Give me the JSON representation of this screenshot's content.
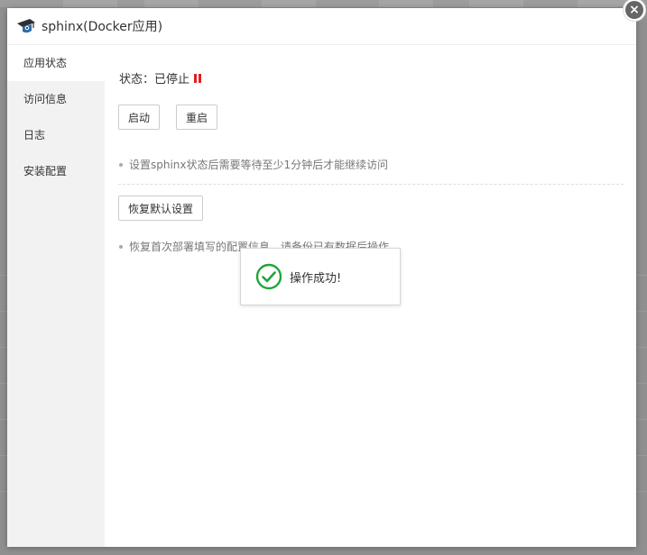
{
  "dialog": {
    "title": "sphinx(Docker应用)",
    "close_icon": "×",
    "logo_icon": "sphinx-logo-icon"
  },
  "sidebar": {
    "items": [
      {
        "label": "应用状态",
        "active": true
      },
      {
        "label": "访问信息",
        "active": false
      },
      {
        "label": "日志",
        "active": false
      },
      {
        "label": "安装配置",
        "active": false
      }
    ]
  },
  "main": {
    "status_label": "状态：已停止",
    "status_color": "#e02020",
    "start_button": "启动",
    "restart_button": "重启",
    "tip_wait": "设置sphinx状态后需要等待至少1分钟后才能继续访问",
    "restore_button": "恢复默认设置",
    "tip_restore": "恢复首次部署填写的配置信息，请备份已有数据后操作"
  },
  "toast": {
    "message": "操作成功!",
    "icon": "check-circle-icon",
    "color": "#20a53a"
  }
}
